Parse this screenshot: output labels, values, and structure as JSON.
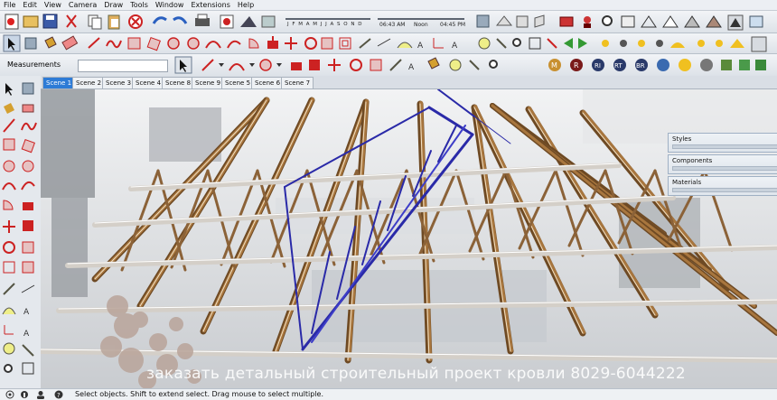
{
  "menu": [
    "File",
    "Edit",
    "View",
    "Camera",
    "Draw",
    "Tools",
    "Window",
    "Extensions",
    "Help"
  ],
  "measurements": {
    "label": "Measurements",
    "value": ""
  },
  "shadow": {
    "months": "J F M A M J J A S O N D",
    "time_current": "06:43 AM",
    "time_noon": "Noon",
    "time_end": "04:45 PM"
  },
  "scenes": [
    "Scene 1",
    "Scene 2",
    "Scene 3",
    "Scene 4",
    "Scene 8",
    "Scene 9",
    "Scene 5",
    "Scene 6",
    "Scene 7"
  ],
  "active_scene": "Scene 1",
  "trays": [
    {
      "title": "Styles"
    },
    {
      "title": "Components"
    },
    {
      "title": "Materials"
    }
  ],
  "watermark": "заказать детальный строительный проект кровли 8029-6044222",
  "status": {
    "text": "Select objects. Shift to extend select. Drag mouse to select multiple."
  },
  "colors": {
    "truss_wood": "#a8763e",
    "highlight_truss": "#2a2aa8",
    "tab_active": "#2d7bd6"
  }
}
